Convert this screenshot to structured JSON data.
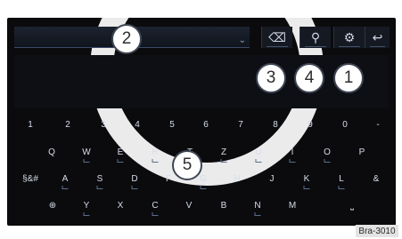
{
  "callouts": {
    "c1": "1",
    "c2": "2",
    "c3": "3",
    "c4": "4",
    "c5": "5"
  },
  "top_buttons": {
    "backspace": "⌫",
    "voice": "⚲",
    "settings": "⚙",
    "back": "↩"
  },
  "keyboard": {
    "row_numbers": [
      "1",
      "2",
      "3",
      "4",
      "5",
      "6",
      "7",
      "8",
      "9",
      "0",
      "-"
    ],
    "row_q": [
      "Q",
      "W",
      "E",
      "R",
      "T",
      "Z",
      "U",
      "I",
      "O",
      "P"
    ],
    "row_a": [
      "§&#",
      "A",
      "S",
      "D",
      "F",
      "G",
      "H",
      "J",
      "K",
      "L",
      "&"
    ],
    "row_y": [
      "⊕",
      "Y",
      "X",
      "C",
      "V",
      "B",
      "N",
      "M",
      "⎵"
    ]
  },
  "credit": "Bra-3010"
}
